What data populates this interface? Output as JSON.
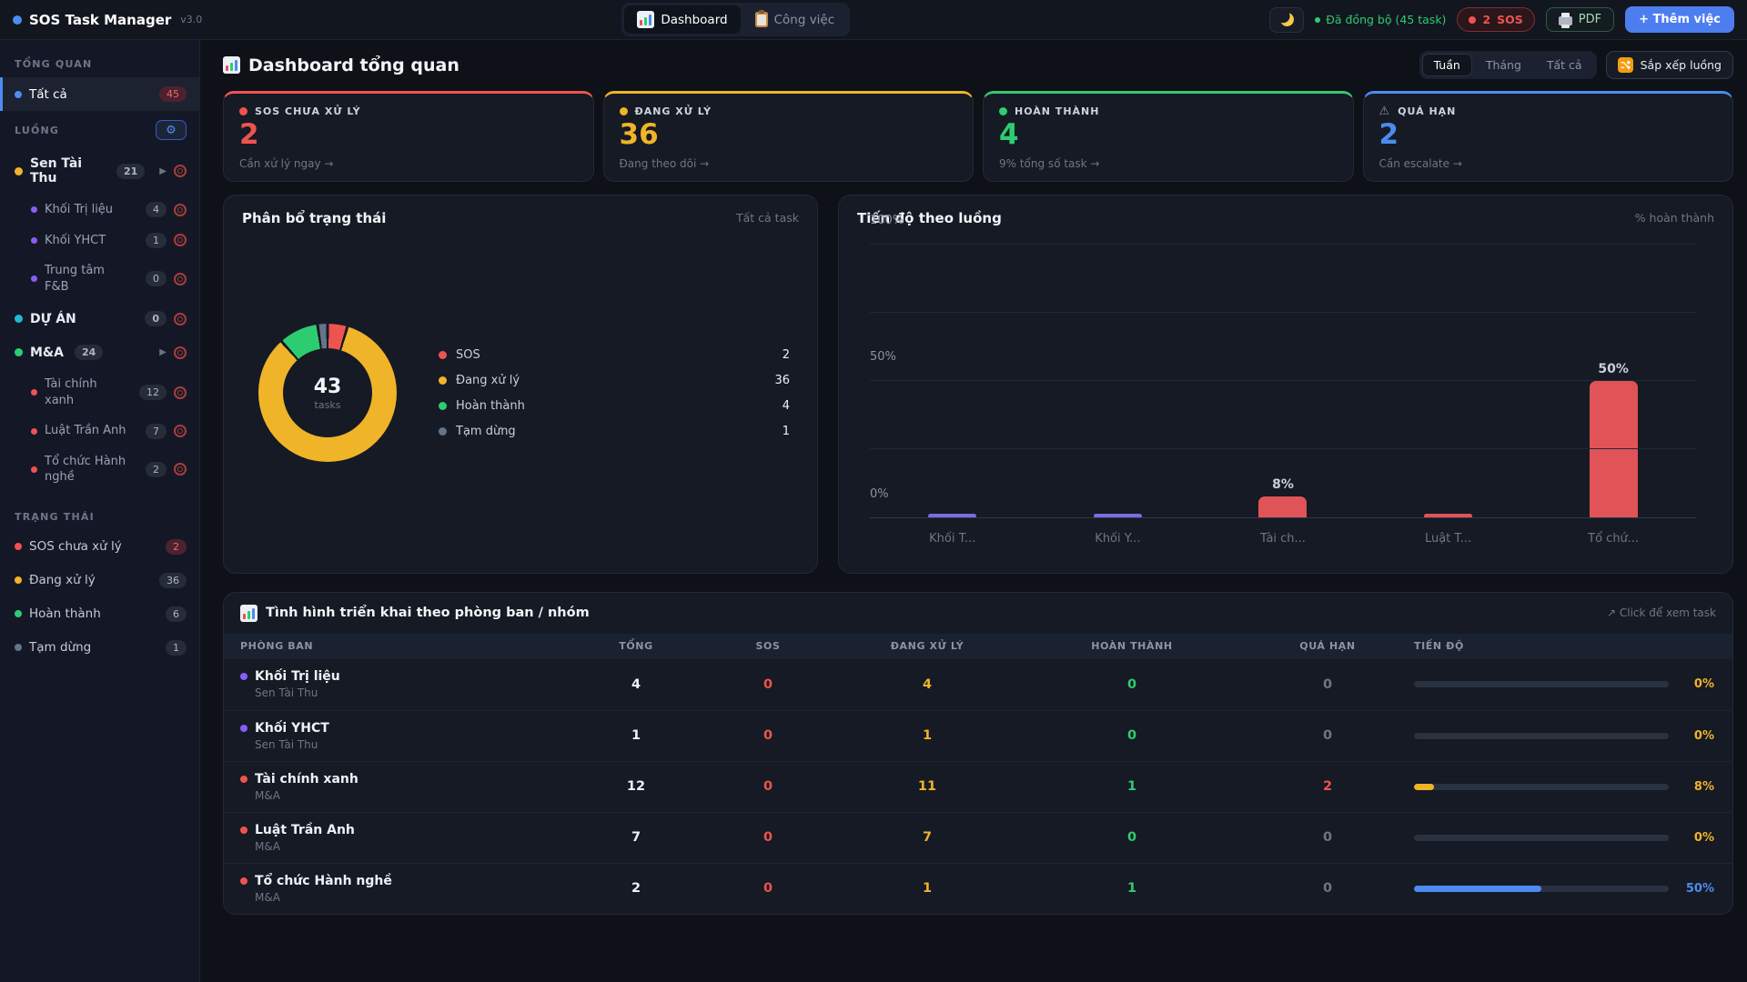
{
  "app": {
    "title": "SOS Task Manager",
    "version": "v3.0"
  },
  "topbar": {
    "tabs": [
      {
        "label": "Dashboard",
        "active": true
      },
      {
        "label": "Công việc",
        "active": false
      }
    ],
    "sync_status": "Đã đồng bộ (45 task)",
    "sos_badge": {
      "count": "2",
      "label": "SOS"
    },
    "pdf_label": "PDF",
    "add_task_label": "+ Thêm việc"
  },
  "sidebar": {
    "sections": {
      "overview": "TỔNG QUAN",
      "flows": "LUỒNG",
      "status": "TRẠNG THÁI"
    },
    "overview_item": {
      "label": "Tất cả",
      "count": "45"
    },
    "flows": [
      {
        "label": "Sen Tài Thu",
        "count": "21",
        "dot": "#f0b429",
        "expandable": true,
        "children": [
          {
            "label": "Khối Trị liệu",
            "count": "4",
            "dot": "#8b5cf6"
          },
          {
            "label": "Khối YHCT",
            "count": "1",
            "dot": "#8b5cf6"
          },
          {
            "label": "Trung tâm F&B",
            "count": "0",
            "dot": "#8b5cf6"
          }
        ]
      },
      {
        "label": "DỰ ÁN",
        "count": "0",
        "dot": "#22b8d4",
        "expandable": false,
        "children": []
      },
      {
        "label": "M&A",
        "count": "24",
        "dot": "#2ecc71",
        "expandable": true,
        "children": [
          {
            "label": "Tài chính xanh",
            "count": "12",
            "dot": "#ef5350"
          },
          {
            "label": "Luật Trần Anh",
            "count": "7",
            "dot": "#ef5350"
          },
          {
            "label": "Tổ chức Hành nghề",
            "count": "2",
            "dot": "#ef5350"
          }
        ]
      }
    ],
    "statuses": [
      {
        "label": "SOS chưa xử lý",
        "count": "2",
        "dot": "#ef5350",
        "alert": true
      },
      {
        "label": "Đang xử lý",
        "count": "36",
        "dot": "#f0b429",
        "alert": false
      },
      {
        "label": "Hoàn thành",
        "count": "6",
        "dot": "#2ecc71",
        "alert": false
      },
      {
        "label": "Tạm dừng",
        "count": "1",
        "dot": "#64748b",
        "alert": false
      }
    ]
  },
  "main": {
    "title": "Dashboard tổng quan",
    "period_tabs": [
      "Tuần",
      "Tháng",
      "Tất cả"
    ],
    "period_active": 0,
    "sort_label": "Sắp xếp luồng",
    "stat_cards": [
      {
        "label": "SOS CHƯA XỬ LÝ",
        "value": "2",
        "footer": "Cần xử lý ngay →",
        "color": "#ef5350",
        "icon": "dot"
      },
      {
        "label": "ĐANG XỬ LÝ",
        "value": "36",
        "footer": "Đang theo dõi →",
        "color": "#f0b429",
        "icon": "dot"
      },
      {
        "label": "HOÀN THÀNH",
        "value": "4",
        "footer": "9% tổng số task →",
        "color": "#2ecc71",
        "icon": "dot"
      },
      {
        "label": "QUÁ HẠN",
        "value": "2",
        "footer": "Cần escalate →",
        "color": "#4d8bf0",
        "icon": "warning"
      }
    ]
  },
  "chart_data": [
    {
      "type": "pie",
      "title": "Phân bổ trạng thái",
      "subtitle": "Tất cả task",
      "center_value": "43",
      "center_label": "tasks",
      "slices": [
        {
          "label": "SOS",
          "value": 2,
          "color": "#ef5350"
        },
        {
          "label": "Đang xử lý",
          "value": 36,
          "color": "#f0b429"
        },
        {
          "label": "Hoàn thành",
          "value": 4,
          "color": "#2ecc71"
        },
        {
          "label": "Tạm dừng",
          "value": 1,
          "color": "#64748b"
        }
      ]
    },
    {
      "type": "bar",
      "title": "Tiến độ theo luồng",
      "subtitle": "% hoàn thành",
      "ylim": [
        0,
        100
      ],
      "grid_values": [
        0,
        25,
        50,
        75,
        100
      ],
      "yticks": [
        {
          "label": "100%",
          "value": 100
        },
        {
          "label": "50%",
          "value": 50
        },
        {
          "label": "0%",
          "value": 0
        }
      ],
      "categories": [
        "Khối T...",
        "Khối Y...",
        "Tài ch...",
        "Luật T...",
        "Tổ chứ..."
      ],
      "values": [
        0,
        0,
        8,
        0,
        50
      ],
      "bar_labels": [
        "",
        "",
        "8%",
        "",
        "50%"
      ],
      "colors": [
        "#7b6cdf",
        "#7b6cdf",
        "#e05356",
        "#e05356",
        "#e05356"
      ]
    }
  ],
  "table": {
    "title": "Tình hình triển khai theo phòng ban / nhóm",
    "hint": "↗ Click để xem task",
    "columns": [
      "PHÒNG BAN",
      "TỔNG",
      "SOS",
      "ĐANG XỬ LÝ",
      "HOÀN THÀNH",
      "QUÁ HẠN",
      "TIẾN ĐỘ"
    ],
    "rows": [
      {
        "name": "Khối Trị liệu",
        "group": "Sen Tài Thu",
        "dot": "#8b5cf6",
        "total": "4",
        "sos": "0",
        "in_progress": "4",
        "done": "0",
        "overdue": "0",
        "overdue_color": "#6e7687",
        "progress": 0,
        "progress_label": "0%",
        "progress_color": "#f0b429"
      },
      {
        "name": "Khối YHCT",
        "group": "Sen Tài Thu",
        "dot": "#8b5cf6",
        "total": "1",
        "sos": "0",
        "in_progress": "1",
        "done": "0",
        "overdue": "0",
        "overdue_color": "#6e7687",
        "progress": 0,
        "progress_label": "0%",
        "progress_color": "#f0b429"
      },
      {
        "name": "Tài chính xanh",
        "group": "M&A",
        "dot": "#ef5350",
        "total": "12",
        "sos": "0",
        "in_progress": "11",
        "done": "1",
        "overdue": "2",
        "overdue_color": "#ef5350",
        "progress": 8,
        "progress_label": "8%",
        "progress_color": "#f0b429"
      },
      {
        "name": "Luật Trần Anh",
        "group": "M&A",
        "dot": "#ef5350",
        "total": "7",
        "sos": "0",
        "in_progress": "7",
        "done": "0",
        "overdue": "0",
        "overdue_color": "#6e7687",
        "progress": 0,
        "progress_label": "0%",
        "progress_color": "#f0b429"
      },
      {
        "name": "Tổ chức Hành nghề",
        "group": "M&A",
        "dot": "#ef5350",
        "total": "2",
        "sos": "0",
        "in_progress": "1",
        "done": "1",
        "overdue": "0",
        "overdue_color": "#6e7687",
        "progress": 50,
        "progress_label": "50%",
        "progress_color": "#4d8bf0"
      }
    ]
  }
}
